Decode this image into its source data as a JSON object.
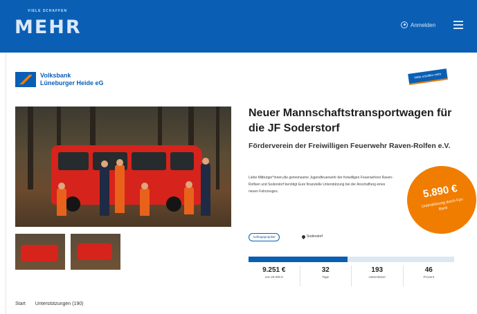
{
  "header": {
    "logo_small": "VIELE SCHAFFEN",
    "logo_big": "MEHR",
    "login_label": "Anmelden"
  },
  "bank": {
    "name_line1": "Volksbank",
    "name_line2": "Lüneburger Heide eG",
    "ribbon": "Viele schaffen mehr"
  },
  "project": {
    "title": "Neuer Mannschaftstransportwagen für die JF Soderstorf",
    "organization": "Förderverein der Freiwilligen Feuerwehr Raven-Rolfen e.V.",
    "description": "Liebe Mitbürger*innen,die gemeinsame Jugendfeuerwehr der freiwilligen Feuerwehren Raven-Rolfsen und Soderstorf benötigt Eure finanzielle Unterstützung bei der Anschaffung eines neuen Fahrzeuges.",
    "tag": "Auftragsprojekte",
    "location": "Soderstorf"
  },
  "bubble": {
    "amount": "5.890 €",
    "label": "Unterstützung durch Fan Bank"
  },
  "progress": {
    "fraction": 0.48
  },
  "stats": [
    {
      "value": "9.251 €",
      "label": "von 20.000 €"
    },
    {
      "value": "32",
      "label": "Tage"
    },
    {
      "value": "193",
      "label": "Unterstützer"
    },
    {
      "value": "46",
      "label": "Prozent"
    }
  ],
  "bottom_nav": {
    "start": "Start",
    "support": "Unterstützungen (190)"
  }
}
